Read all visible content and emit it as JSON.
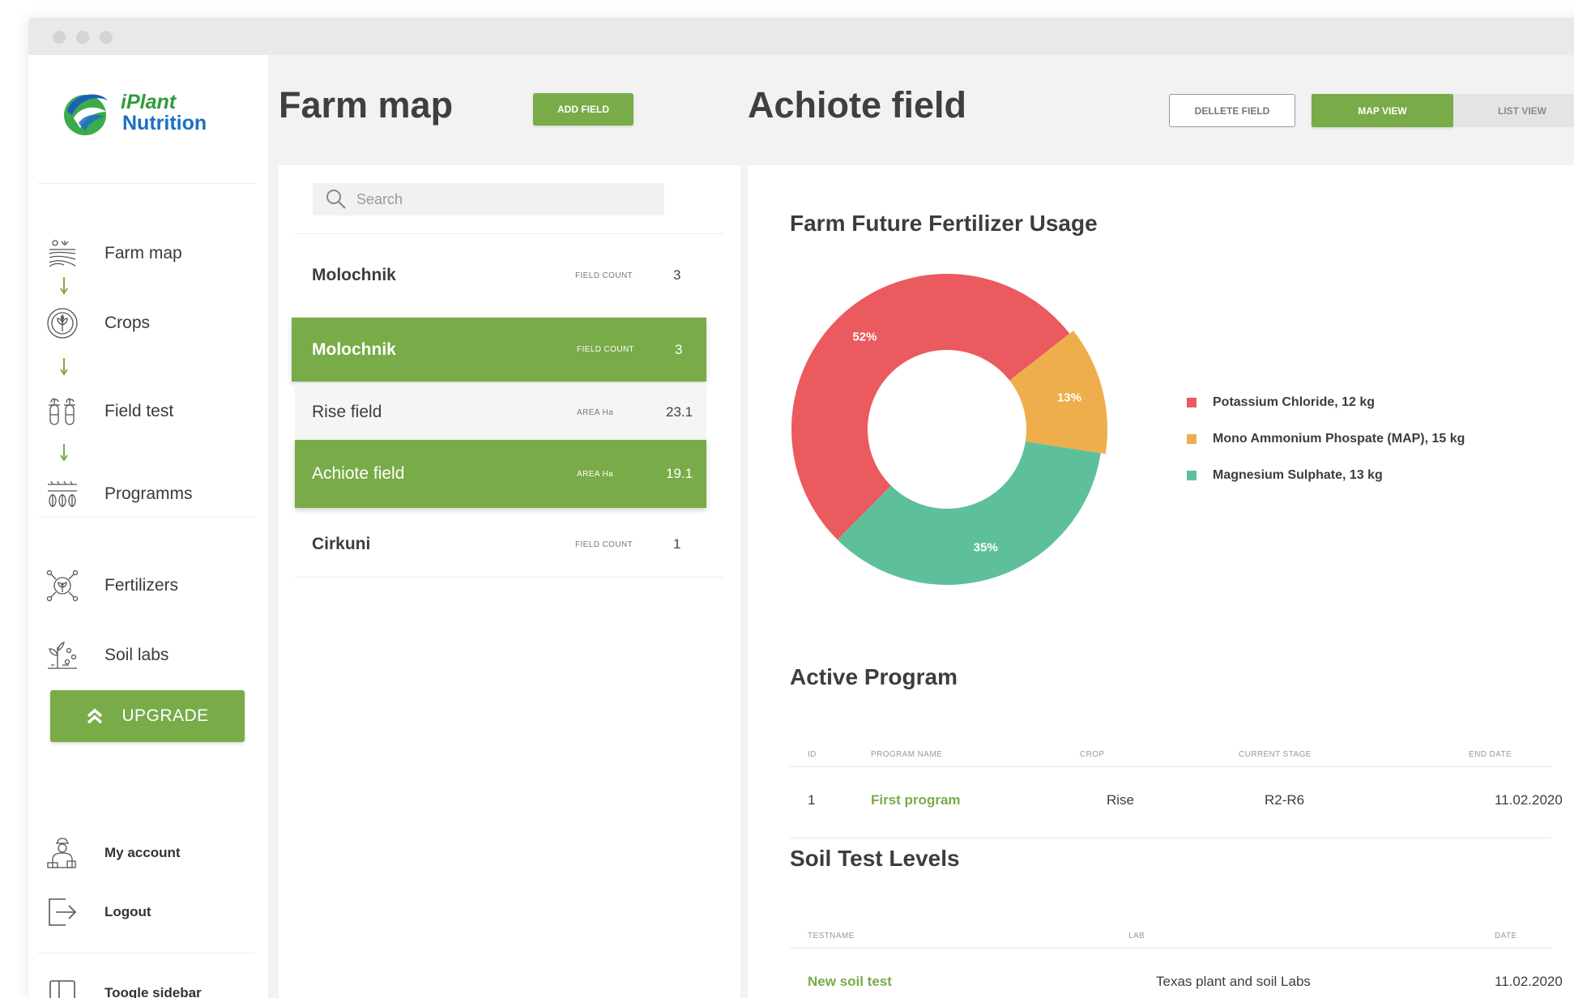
{
  "brand": {
    "line1": "iPlant",
    "line2": "Nutrition"
  },
  "sidebar": {
    "items": [
      {
        "label": "Farm map"
      },
      {
        "label": "Crops"
      },
      {
        "label": "Field test"
      },
      {
        "label": "Programms"
      },
      {
        "label": "Fertilizers"
      },
      {
        "label": "Soil labs"
      }
    ],
    "upgrade_label": "UPGRADE",
    "bottom": [
      {
        "label": "My account"
      },
      {
        "label": "Logout"
      },
      {
        "label": "Toogle sidebar"
      }
    ]
  },
  "header": {
    "left_title": "Farm map",
    "add_field_label": "ADD FIELD",
    "right_title": "Achiote field",
    "delete_label": "DELLETE FIELD",
    "map_view_label": "MAP VIEW",
    "list_view_label": "LIST VIEW"
  },
  "search": {
    "placeholder": "Search",
    "value": ""
  },
  "fields": [
    {
      "name": "Molochnik",
      "meta": "FIELD COUNT",
      "value": "3",
      "selected": false
    },
    {
      "name": "Molochnik",
      "meta": "FIELD COUNT",
      "value": "3",
      "selected": true
    },
    {
      "name": "Rise field",
      "meta": "AREA Ha",
      "value": "23.1",
      "selected": false
    },
    {
      "name": "Achiote field",
      "meta": "AREA Ha",
      "value": "19.1",
      "selected": true
    },
    {
      "name": "Cirkuni",
      "meta": "FIELD COUNT",
      "value": "1",
      "selected": false
    }
  ],
  "colors": {
    "accent": "#79ab48",
    "red": "#ea5a5e",
    "orange": "#efae4c",
    "teal": "#5ec09b"
  },
  "fertilizer_usage": {
    "title": "Farm Future Fertilizer Usage",
    "chart_data": {
      "type": "pie",
      "title": "Farm Future Fertilizer Usage",
      "series": [
        {
          "name": "Potassium Chloride, 12 kg",
          "value": 52,
          "label": "52%",
          "color": "#ea5a5e"
        },
        {
          "name": "Mono Ammonium Phospate (MAP), 15 kg",
          "value": 13,
          "label": "13%",
          "color": "#efae4c"
        },
        {
          "name": "Magnesium Sulphate, 13 kg",
          "value": 35,
          "label": "35%",
          "color": "#5ec09b"
        }
      ],
      "legend": "right"
    }
  },
  "active_program": {
    "title": "Active Program",
    "headers": [
      "ID",
      "PROGRAM NAME",
      "CROP",
      "CURRENT STAGE",
      "END DATE"
    ],
    "rows": [
      {
        "id": "1",
        "name": "First program",
        "crop": "Rise",
        "stage": "R2-R6",
        "end": "11.02.2020"
      }
    ]
  },
  "soil_test": {
    "title": "Soil Test Levels",
    "headers": [
      "TESTNAME",
      "LAB",
      "DATE"
    ],
    "rows": [
      {
        "name": "New soil test",
        "lab": "Texas plant and soil Labs",
        "date": "11.02.2020"
      }
    ]
  }
}
